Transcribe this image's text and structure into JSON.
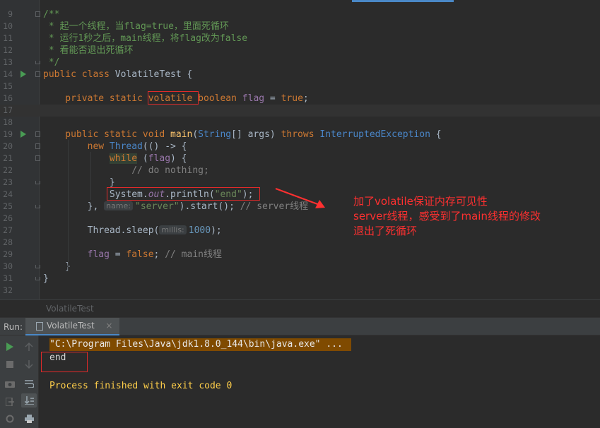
{
  "editor": {
    "lines": [
      {
        "num": "9",
        "segs": [
          {
            "c": "doc",
            "t": "/**"
          }
        ]
      },
      {
        "num": "10",
        "segs": [
          {
            "c": "doc",
            "t": " * 起一个线程，当flag=true，里面死循环"
          }
        ]
      },
      {
        "num": "11",
        "segs": [
          {
            "c": "doc",
            "t": " * 运行1秒之后，main线程，将flag改为false"
          }
        ]
      },
      {
        "num": "12",
        "segs": [
          {
            "c": "doc",
            "t": " * 看能否退出死循环"
          }
        ]
      },
      {
        "num": "13",
        "segs": [
          {
            "c": "doc",
            "t": " */"
          }
        ]
      },
      {
        "num": "14",
        "segs": [
          {
            "c": "kw",
            "t": "public class "
          },
          {
            "c": "cls",
            "t": "VolatileTest {"
          }
        ]
      },
      {
        "num": "15",
        "segs": []
      },
      {
        "num": "16",
        "segs": [
          {
            "c": "kw",
            "t": "    private static "
          },
          {
            "c": "kw",
            "t": "volatile"
          },
          {
            "c": "kw",
            "t": " boolean "
          },
          {
            "c": "fld",
            "t": "flag"
          },
          {
            "c": "cls",
            "t": " = "
          },
          {
            "c": "kw",
            "t": "true"
          },
          {
            "c": "cls",
            "t": ";"
          }
        ]
      },
      {
        "num": "17",
        "segs": []
      },
      {
        "num": "18",
        "segs": []
      },
      {
        "num": "19",
        "segs": [
          {
            "c": "kw",
            "t": "    public static void "
          },
          {
            "c": "fn",
            "t": "main"
          },
          {
            "c": "cls",
            "t": "("
          },
          {
            "c": "typ",
            "t": "String"
          },
          {
            "c": "cls",
            "t": "[] args) "
          },
          {
            "c": "kw",
            "t": "throws "
          },
          {
            "c": "typ",
            "t": "InterruptedException"
          },
          {
            "c": "cls",
            "t": " {"
          }
        ]
      },
      {
        "num": "20",
        "segs": [
          {
            "c": "kw",
            "t": "        new "
          },
          {
            "c": "typ",
            "t": "Thread"
          },
          {
            "c": "cls",
            "t": "(() -> {"
          }
        ]
      },
      {
        "num": "21",
        "segs": [
          {
            "c": "cls",
            "t": "            "
          },
          {
            "c": "kw hl",
            "t": "while"
          },
          {
            "c": "cls",
            "t": " ("
          },
          {
            "c": "fld",
            "t": "flag"
          },
          {
            "c": "cls",
            "t": ") {"
          }
        ]
      },
      {
        "num": "22",
        "segs": [
          {
            "c": "cm",
            "t": "                // do nothing;"
          }
        ]
      },
      {
        "num": "23",
        "segs": [
          {
            "c": "cls",
            "t": "            }"
          }
        ]
      },
      {
        "num": "24",
        "segs": [
          {
            "c": "cls",
            "t": "            System."
          },
          {
            "c": "st",
            "t": "out"
          },
          {
            "c": "cls",
            "t": ".println("
          },
          {
            "c": "str",
            "t": "\"end\""
          },
          {
            "c": "cls",
            "t": ");"
          }
        ]
      },
      {
        "num": "25",
        "segs": [
          {
            "c": "cls",
            "t": "        }, "
          },
          {
            "c": "hint",
            "t": "name:"
          },
          {
            "c": "str",
            "t": "\"server\""
          },
          {
            "c": "cls",
            "t": ").start(); "
          },
          {
            "c": "cm",
            "t": "// server线程"
          }
        ]
      },
      {
        "num": "26",
        "segs": []
      },
      {
        "num": "27",
        "segs": [
          {
            "c": "cls",
            "t": "        Thread.sleep("
          },
          {
            "c": "hint",
            "t": "millis:"
          },
          {
            "c": "num",
            "t": "1000"
          },
          {
            "c": "cls",
            "t": ");"
          }
        ]
      },
      {
        "num": "28",
        "segs": []
      },
      {
        "num": "29",
        "segs": [
          {
            "c": "fld",
            "t": "        flag"
          },
          {
            "c": "cls",
            "t": " = "
          },
          {
            "c": "kw",
            "t": "false"
          },
          {
            "c": "cls",
            "t": "; "
          },
          {
            "c": "cm",
            "t": "// main线程"
          }
        ]
      },
      {
        "num": "30",
        "segs": [
          {
            "c": "cls",
            "t": "    }"
          }
        ]
      },
      {
        "num": "31",
        "segs": [
          {
            "c": "cls",
            "t": "}"
          }
        ]
      },
      {
        "num": "32",
        "segs": []
      }
    ],
    "annotation": [
      "加了volatile保证内存可见性",
      "server线程，感受到了main线程的修改",
      "退出了死循环"
    ]
  },
  "breadcrumb": "VolatileTest",
  "run_panel": {
    "label": "Run:",
    "tab_label": "VolatileTest",
    "close_glyph": "×",
    "console_lines": [
      "\"C:\\Program Files\\Java\\jdk1.8.0_144\\bin\\java.exe\" ...",
      "end",
      "Process finished with exit code 0"
    ]
  },
  "colors": {
    "accent": "#4a88c7",
    "annotation": "#ff3030",
    "run": "#499c54"
  }
}
